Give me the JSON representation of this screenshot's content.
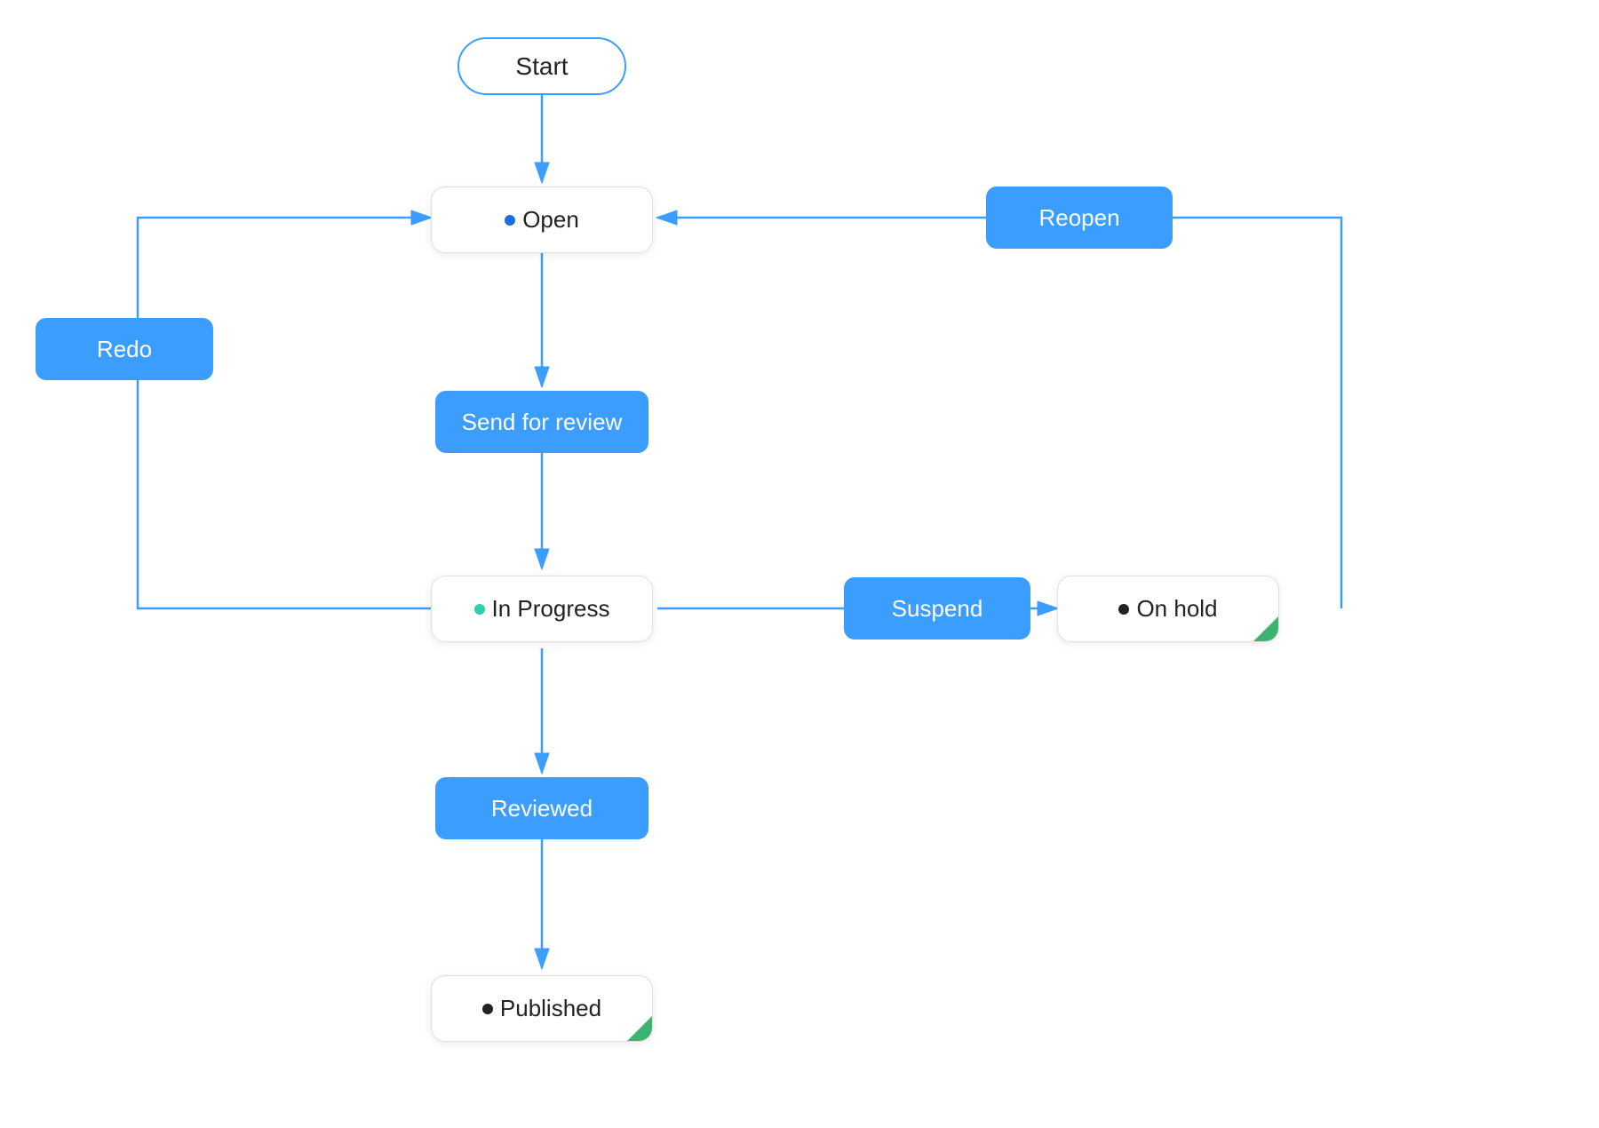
{
  "nodes": {
    "start": {
      "label": "Start"
    },
    "open": {
      "label": "Open",
      "dot": "blue"
    },
    "send_for_review": {
      "label": "Send for review"
    },
    "in_progress": {
      "label": "In Progress",
      "dot": "teal"
    },
    "redo": {
      "label": "Redo"
    },
    "suspend": {
      "label": "Suspend"
    },
    "on_hold": {
      "label": "On hold",
      "dot": "black"
    },
    "reopen": {
      "label": "Reopen"
    },
    "reviewed": {
      "label": "Reviewed"
    },
    "published": {
      "label": "Published",
      "dot": "black"
    }
  },
  "colors": {
    "blue": "#3b9eff",
    "arrow": "#3b9eff",
    "state_border": "#e0e0e0"
  }
}
